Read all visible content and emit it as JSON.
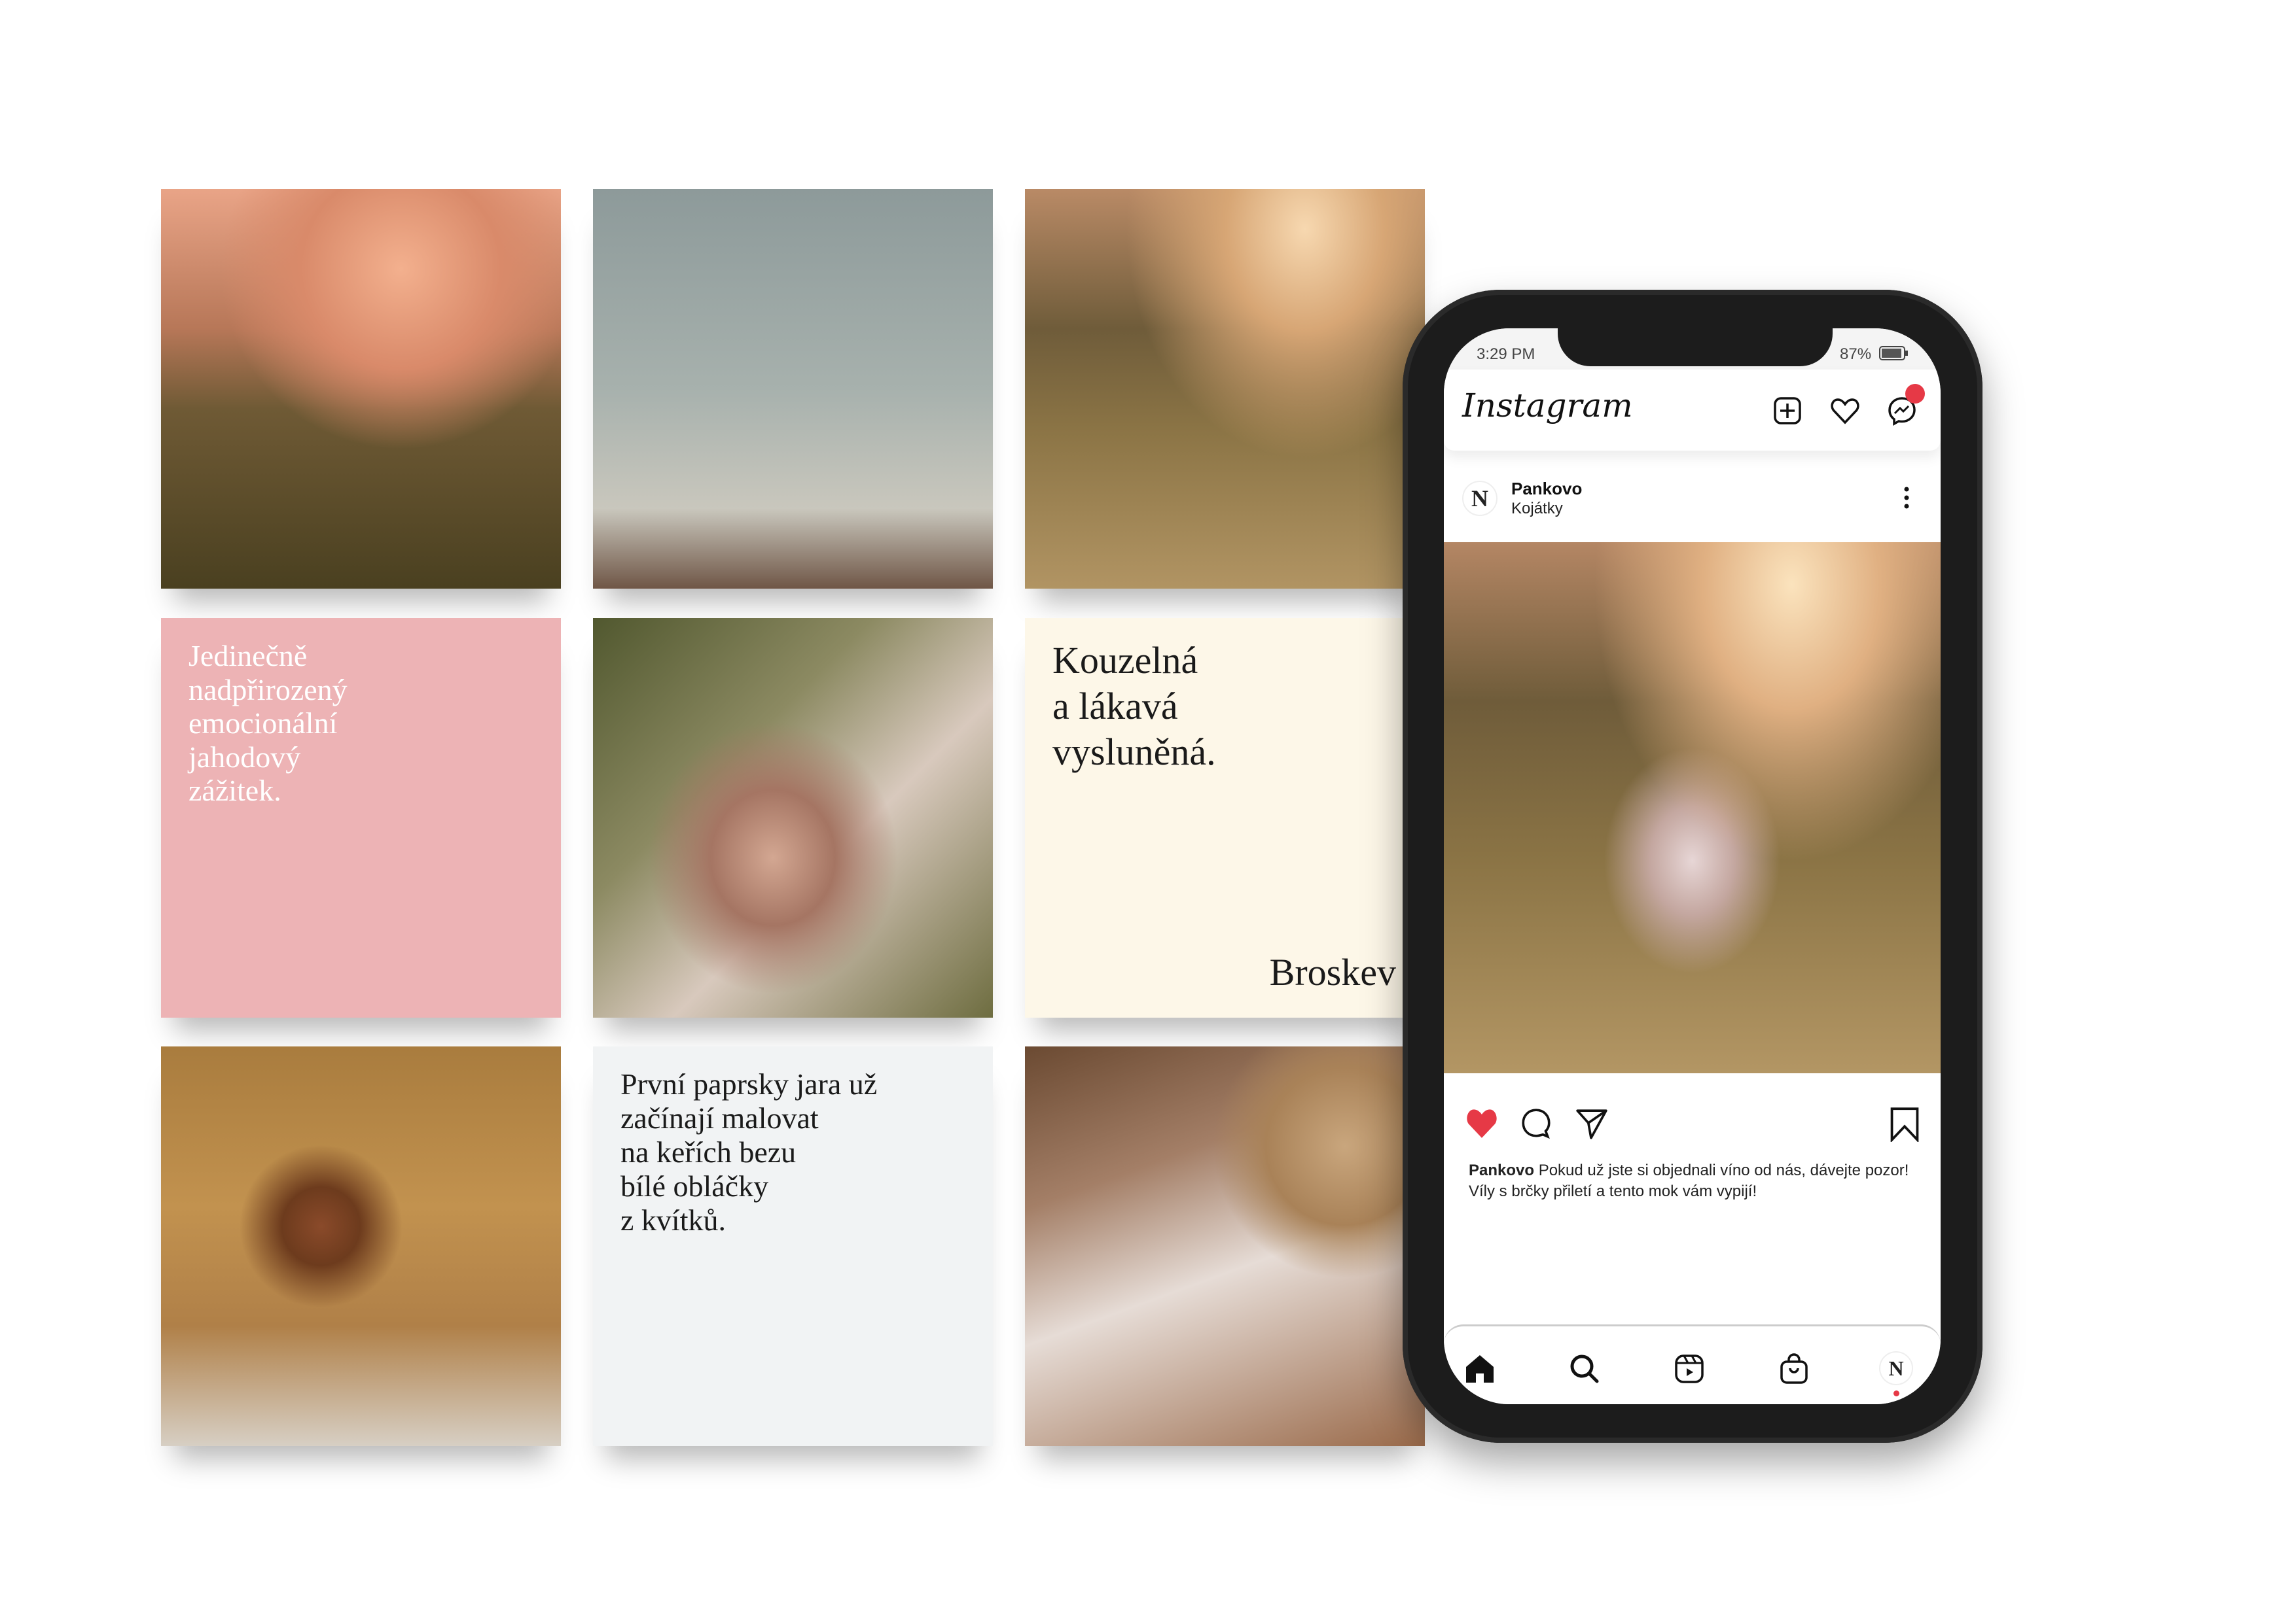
{
  "tiles": {
    "pink_text": "Jedinečně nadpřirozený emocionální jahodový zážitek.",
    "pink_lines": [
      "Jedinečně",
      "nadpřirozený",
      "emocionální",
      "jahodový",
      "zážitek."
    ],
    "cream_lines": [
      "Kouzelná",
      "a lákavá",
      "vysluněná."
    ],
    "cream_footer": "Broskev",
    "grey_lines": [
      "První paprsky jara už",
      "začínají malovat",
      "na keřích bezu",
      "bílé obláčky",
      "z kvítků."
    ]
  },
  "phone": {
    "status": {
      "time": "3:29 PM",
      "battery": "87%"
    },
    "app_logo": "Instagram",
    "post": {
      "username": "Pankovo",
      "location": "Kojátky",
      "avatar_letter": "N",
      "liked": true,
      "caption_user": "Pankovo",
      "caption_text": "Pokud už jste si objednali víno od nás, dávejte pozor! Víly s brčky přiletí a tento mok vám vypijí!"
    },
    "colors": {
      "like": "#e63946",
      "badge": "#e63946",
      "pink_tile": "#edb3b5",
      "cream_tile": "#fdf7e8",
      "grey_tile": "#f1f3f4"
    }
  }
}
